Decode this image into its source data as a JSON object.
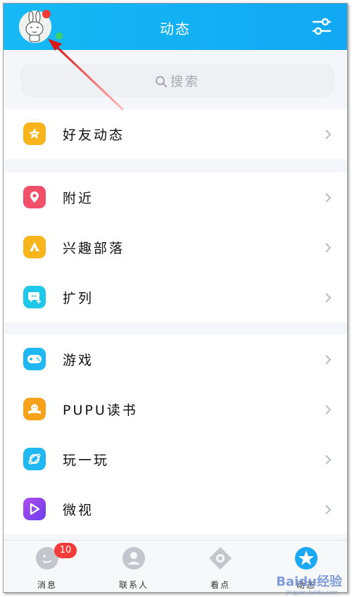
{
  "header": {
    "title": "动态"
  },
  "search": {
    "placeholder": "搜索"
  },
  "sections": [
    {
      "items": [
        {
          "label": "好友动态",
          "icon": "star-icon",
          "color": "#f7b51b"
        }
      ]
    },
    {
      "items": [
        {
          "label": "附近",
          "icon": "location-pin-icon",
          "color": "#f2506a"
        },
        {
          "label": "兴趣部落",
          "icon": "tent-icon",
          "color": "#f7b51b"
        },
        {
          "label": "扩列",
          "icon": "chat-bubble-plus-icon",
          "color": "#1fc8e8"
        }
      ]
    },
    {
      "items": [
        {
          "label": "游戏",
          "icon": "gamepad-icon",
          "color": "#20b8f3"
        },
        {
          "label": "PUPU读书",
          "icon": "book-icon",
          "color": "#f7a21b"
        },
        {
          "label": "玩一玩",
          "icon": "planet-icon",
          "color": "#20b8f3"
        },
        {
          "label": "微视",
          "icon": "play-icon",
          "color": "#8a47ee"
        }
      ]
    }
  ],
  "tabbar": {
    "tabs": [
      {
        "label": "消息",
        "badge": "10"
      },
      {
        "label": "联系人"
      },
      {
        "label": "看点"
      },
      {
        "label": "动态"
      }
    ]
  },
  "watermark": {
    "text": "Baidu经验",
    "sub": "jingyan.baidu.com"
  },
  "colors": {
    "header": "#16b9f5",
    "badge": "#f43b3b",
    "online": "#3bd06a",
    "arrow": "#e02020"
  }
}
